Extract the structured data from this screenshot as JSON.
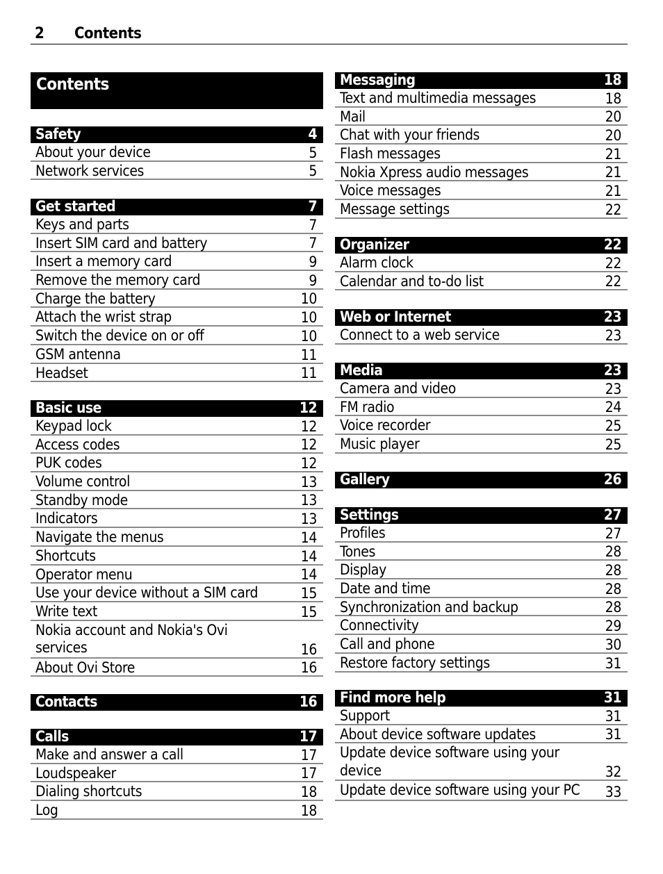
{
  "header": {
    "page_number": "2",
    "title": "Contents"
  },
  "contents_title": "Contents",
  "left_sections": [
    {
      "title": "Safety",
      "page": "4",
      "entries": [
        {
          "title": "About your device",
          "page": "5"
        },
        {
          "title": "Network services",
          "page": "5"
        }
      ]
    },
    {
      "title": "Get started",
      "page": "7",
      "entries": [
        {
          "title": "Keys and parts",
          "page": "7"
        },
        {
          "title": "Insert SIM card and battery",
          "page": "7"
        },
        {
          "title": "Insert a memory card",
          "page": "9"
        },
        {
          "title": "Remove the memory card",
          "page": "9"
        },
        {
          "title": "Charge the battery",
          "page": "10"
        },
        {
          "title": "Attach the wrist strap",
          "page": "10"
        },
        {
          "title": "Switch the device on or off",
          "page": "10"
        },
        {
          "title": "GSM antenna",
          "page": "11"
        },
        {
          "title": "Headset",
          "page": "11"
        }
      ]
    },
    {
      "title": "Basic use",
      "page": "12",
      "entries": [
        {
          "title": "Keypad lock",
          "page": "12"
        },
        {
          "title": "Access codes",
          "page": "12"
        },
        {
          "title": "PUK codes",
          "page": "12"
        },
        {
          "title": "Volume control",
          "page": "13"
        },
        {
          "title": "Standby mode",
          "page": "13"
        },
        {
          "title": "Indicators",
          "page": "13"
        },
        {
          "title": "Navigate the menus",
          "page": "14"
        },
        {
          "title": "Shortcuts",
          "page": "14"
        },
        {
          "title": "Operator menu",
          "page": "14"
        },
        {
          "title": "Use your device without a SIM card",
          "page": "15"
        },
        {
          "title": "Write text",
          "page": "15"
        },
        {
          "title": "Nokia account and Nokia's Ovi services",
          "page": "16"
        },
        {
          "title": "About Ovi Store",
          "page": "16"
        }
      ]
    },
    {
      "title": "Contacts",
      "page": "16",
      "entries": []
    },
    {
      "title": "Calls",
      "page": "17",
      "entries": [
        {
          "title": "Make and answer a call",
          "page": "17"
        },
        {
          "title": "Loudspeaker",
          "page": "17"
        },
        {
          "title": "Dialing shortcuts",
          "page": "18"
        },
        {
          "title": "Log",
          "page": "18"
        }
      ]
    }
  ],
  "right_sections": [
    {
      "title": "Messaging",
      "page": "18",
      "entries": [
        {
          "title": "Text and multimedia messages",
          "page": "18"
        },
        {
          "title": "Mail",
          "page": "20"
        },
        {
          "title": "Chat with your friends",
          "page": "20"
        },
        {
          "title": "Flash messages",
          "page": "21"
        },
        {
          "title": "Nokia Xpress audio messages",
          "page": "21"
        },
        {
          "title": "Voice messages",
          "page": "21"
        },
        {
          "title": "Message settings",
          "page": "22"
        }
      ]
    },
    {
      "title": "Organizer",
      "page": "22",
      "entries": [
        {
          "title": "Alarm clock",
          "page": "22"
        },
        {
          "title": "Calendar and to-do list",
          "page": "22"
        }
      ]
    },
    {
      "title": "Web or Internet",
      "page": "23",
      "entries": [
        {
          "title": "Connect to a web service",
          "page": "23"
        }
      ]
    },
    {
      "title": "Media",
      "page": "23",
      "entries": [
        {
          "title": "Camera and video",
          "page": "23"
        },
        {
          "title": "FM radio",
          "page": "24"
        },
        {
          "title": "Voice recorder",
          "page": "25"
        },
        {
          "title": "Music player",
          "page": "25"
        }
      ]
    },
    {
      "title": "Gallery",
      "page": "26",
      "entries": []
    },
    {
      "title": "Settings",
      "page": "27",
      "entries": [
        {
          "title": "Profiles",
          "page": "27"
        },
        {
          "title": "Tones",
          "page": "28"
        },
        {
          "title": "Display",
          "page": "28"
        },
        {
          "title": "Date and time",
          "page": "28"
        },
        {
          "title": "Synchronization and backup",
          "page": "28"
        },
        {
          "title": "Connectivity",
          "page": "29"
        },
        {
          "title": "Call and phone",
          "page": "30"
        },
        {
          "title": "Restore factory settings",
          "page": "31"
        }
      ]
    },
    {
      "title": "Find more help",
      "page": "31",
      "entries": [
        {
          "title": "Support",
          "page": "31"
        },
        {
          "title": "About device software updates",
          "page": "31"
        },
        {
          "title": "Update device software using your device",
          "page": "32"
        },
        {
          "title": "Update device software using your PC",
          "page": "33"
        }
      ]
    }
  ]
}
